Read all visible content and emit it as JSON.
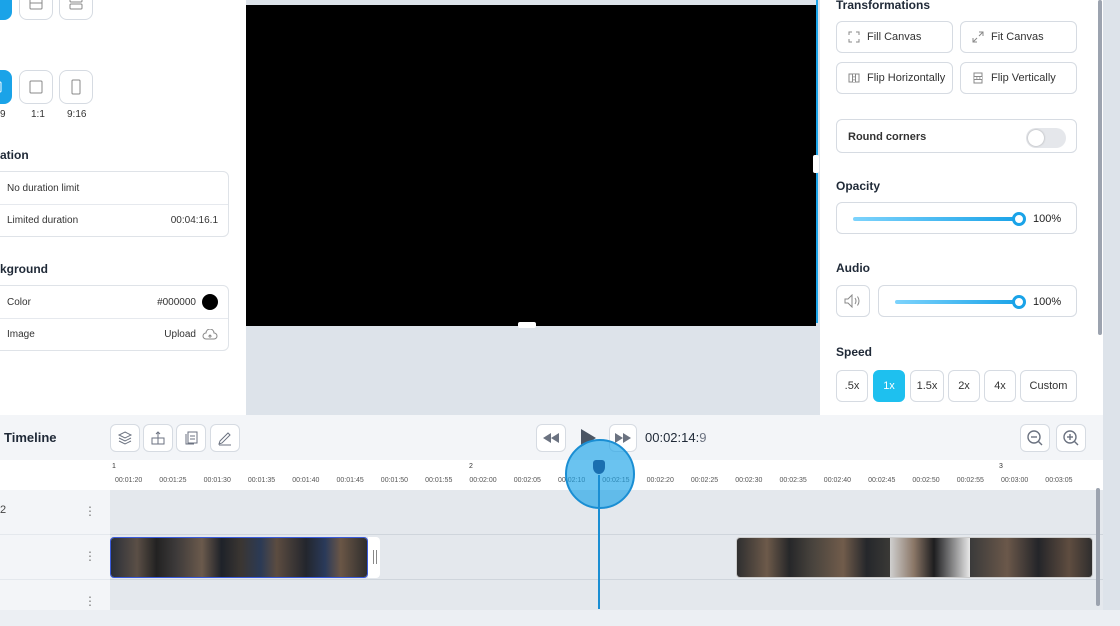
{
  "left": {
    "ratios": [
      {
        "label": "9",
        "active": true
      },
      {
        "label": "1:1",
        "active": false
      },
      {
        "label": "9:16",
        "active": false
      }
    ],
    "duration": {
      "title": "ation",
      "options": [
        {
          "label": "No duration limit",
          "value": ""
        },
        {
          "label": "Limited duration",
          "value": "00:04:16.1"
        }
      ]
    },
    "background": {
      "title": "kground",
      "color_label": "Color",
      "color_value": "#000000",
      "image_label": "Image",
      "image_action": "Upload"
    }
  },
  "right": {
    "transformations_title": "Transformations",
    "buttons": {
      "fill_canvas": "Fill Canvas",
      "fit_canvas": "Fit Canvas",
      "flip_h": "Flip Horizontally",
      "flip_v": "Flip Vertically"
    },
    "round_corners": {
      "label": "Round corners",
      "enabled": false
    },
    "opacity": {
      "title": "Opacity",
      "value": "100%",
      "level": 1.0
    },
    "audio": {
      "title": "Audio",
      "value": "100%",
      "level": 1.0
    },
    "speed": {
      "title": "Speed",
      "options": [
        {
          "label": ".5x",
          "active": false
        },
        {
          "label": "1x",
          "active": true
        },
        {
          "label": "1.5x",
          "active": false
        },
        {
          "label": "2x",
          "active": false
        },
        {
          "label": "4x",
          "active": false
        },
        {
          "label": "Custom",
          "active": false
        }
      ]
    }
  },
  "timeline": {
    "title": "Timeline",
    "time_main": "00:02:14:",
    "time_frame": "9",
    "markers": [
      {
        "label": "1"
      },
      {
        "label": "2"
      },
      {
        "label": "3"
      }
    ],
    "ticks": [
      "00:01:20",
      "00:01:25",
      "00:01:30",
      "00:01:35",
      "00:01:40",
      "00:01:45",
      "00:01:50",
      "00:01:55",
      "00:02:00",
      "00:02:05",
      "00:02:10",
      "00:02:15",
      "00:02:20",
      "00:02:25",
      "00:02:30",
      "00:02:35",
      "00:02:40",
      "00:02:45",
      "00:02:50",
      "00:02:55",
      "00:03:00",
      "00:03:05"
    ],
    "tracks": [
      {
        "num": "2"
      },
      {
        "num": ""
      },
      {
        "num": ""
      }
    ]
  },
  "colors": {
    "accent": "#1aa3e8",
    "speed_active": "#1ec0ef",
    "preview_bg": "#000000"
  }
}
